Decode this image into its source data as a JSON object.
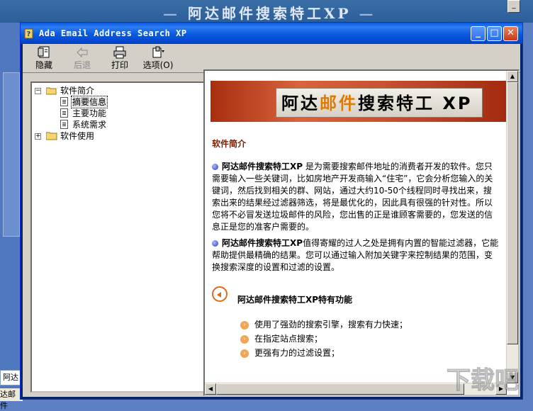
{
  "background": {
    "title": "阿达邮件搜索特工XP",
    "left_field": "阿达",
    "bottom_text": "达邮件"
  },
  "window": {
    "title": "Ada Email Address Search XP"
  },
  "toolbar": {
    "hide_label": "隐藏",
    "back_label": "后退",
    "print_label": "打印",
    "options_label": "选项(O)"
  },
  "tree": [
    {
      "label": "软件简介",
      "type": "folder",
      "expanded": true
    },
    {
      "label": "摘要信息",
      "type": "page",
      "selected": true
    },
    {
      "label": "主要功能",
      "type": "page"
    },
    {
      "label": "系统需求",
      "type": "page"
    },
    {
      "label": "软件使用",
      "type": "folder",
      "expanded": false
    }
  ],
  "content": {
    "banner": {
      "prefix": "阿达",
      "highlight": "邮件",
      "suffix": "搜索特工 XP"
    },
    "heading": "软件简介",
    "paragraph1_bold": "阿达邮件搜索特工XP",
    "paragraph1_text": " 是为需要搜索邮件地址的消费者开发的软件。您只需要输入一些关键词，比如房地产开发商输入“住宅”，它会分析您输入的关键词，然后找到相关的群、网站，通过大约10-50个线程同时寻找出来，搜索出来的结果经过滤器筛选，将是最优化的，因此具有很强的针对性。所以您将不必冒发送垃圾邮件的风险，您出售的正是谁顾客需要的，您发送的信息正是您的准客户需要的。",
    "paragraph2_bold": "阿达邮件搜索特工XP",
    "paragraph2_text": "值得寄耀的过人之处是拥有内置的智能过滤器，它能帮助提供最精确的结果。您可以通过输入附加关键字来控制结果的范围，变换搜索深度的设置和过滤的设置。",
    "features_title": "阿达邮件搜索特工XP特有功能",
    "features": [
      "使用了强劲的搜索引擎，搜索有力快速；",
      "在指定站点搜索；",
      "更强有力的过滤设置；"
    ]
  },
  "colors": {
    "titlebar": "#0a58e2",
    "heading": "#7a1e00",
    "banner": "#c75031",
    "highlight": "#e07b00"
  }
}
